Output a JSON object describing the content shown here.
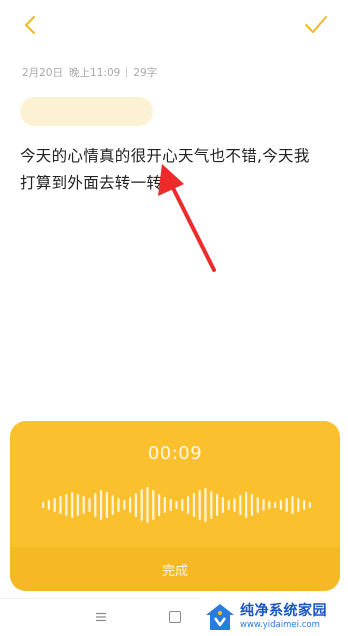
{
  "header": {
    "back_icon": "chevron-left-icon",
    "confirm_icon": "checkmark-icon",
    "accent": "#f2b62a"
  },
  "meta": {
    "date": "2月20日",
    "time": "晚上11:09",
    "count": "29字"
  },
  "note": {
    "text": "今天的心情真的很开心天气也不错,今天我打算到外面去转一转,"
  },
  "recorder": {
    "timer": "00:09",
    "finish_label": "完成",
    "background": "#fbc02d"
  },
  "nav": {
    "menu_icon": "menu-icon",
    "home_icon": "home-icon"
  },
  "watermark": {
    "title": "纯净系统家园",
    "url": "www.yidaimei.com"
  }
}
